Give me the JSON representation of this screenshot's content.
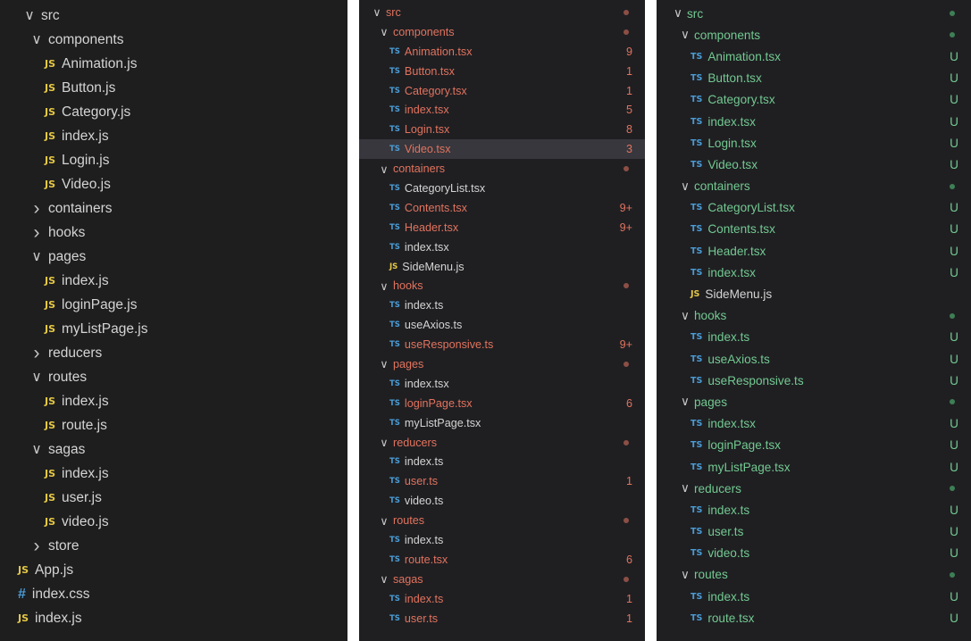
{
  "colors": {
    "default": "#d4d4d4",
    "modified": "#e2735e",
    "untracked": "#73c991",
    "modified_dot": "#8c4f45",
    "untracked_dot": "#3e7f55"
  },
  "panels": [
    {
      "id": "p1",
      "rows": [
        {
          "indent": 0,
          "kind": "folder",
          "open": true,
          "name": "src"
        },
        {
          "indent": 1,
          "kind": "folder",
          "open": true,
          "name": "components"
        },
        {
          "indent": 2,
          "kind": "file",
          "ft": "JS",
          "name": "Animation.js"
        },
        {
          "indent": 2,
          "kind": "file",
          "ft": "JS",
          "name": "Button.js"
        },
        {
          "indent": 2,
          "kind": "file",
          "ft": "JS",
          "name": "Category.js"
        },
        {
          "indent": 2,
          "kind": "file",
          "ft": "JS",
          "name": "index.js"
        },
        {
          "indent": 2,
          "kind": "file",
          "ft": "JS",
          "name": "Login.js"
        },
        {
          "indent": 2,
          "kind": "file",
          "ft": "JS",
          "name": "Video.js"
        },
        {
          "indent": 1,
          "kind": "folder",
          "open": false,
          "name": "containers"
        },
        {
          "indent": 1,
          "kind": "folder",
          "open": false,
          "name": "hooks"
        },
        {
          "indent": 1,
          "kind": "folder",
          "open": true,
          "name": "pages"
        },
        {
          "indent": 2,
          "kind": "file",
          "ft": "JS",
          "name": "index.js"
        },
        {
          "indent": 2,
          "kind": "file",
          "ft": "JS",
          "name": "loginPage.js"
        },
        {
          "indent": 2,
          "kind": "file",
          "ft": "JS",
          "name": "myListPage.js"
        },
        {
          "indent": 1,
          "kind": "folder",
          "open": false,
          "name": "reducers"
        },
        {
          "indent": 1,
          "kind": "folder",
          "open": true,
          "name": "routes"
        },
        {
          "indent": 2,
          "kind": "file",
          "ft": "JS",
          "name": "index.js"
        },
        {
          "indent": 2,
          "kind": "file",
          "ft": "JS",
          "name": "route.js"
        },
        {
          "indent": 1,
          "kind": "folder",
          "open": true,
          "name": "sagas"
        },
        {
          "indent": 2,
          "kind": "file",
          "ft": "JS",
          "name": "index.js"
        },
        {
          "indent": 2,
          "kind": "file",
          "ft": "JS",
          "name": "user.js"
        },
        {
          "indent": 2,
          "kind": "file",
          "ft": "JS",
          "name": "video.js"
        },
        {
          "indent": 1,
          "kind": "folder",
          "open": false,
          "name": "store"
        },
        {
          "indent": 1,
          "kind": "file",
          "ft": "JS",
          "name": "App.js"
        },
        {
          "indent": 1,
          "kind": "file",
          "ft": "#",
          "name": "index.css"
        },
        {
          "indent": 1,
          "kind": "file",
          "ft": "JS",
          "name": "index.js"
        }
      ]
    },
    {
      "id": "p2",
      "rows": [
        {
          "indent": 0,
          "kind": "folder",
          "open": true,
          "name": "src",
          "status": "modified",
          "dot": true
        },
        {
          "indent": 1,
          "kind": "folder",
          "open": true,
          "name": "components",
          "status": "modified",
          "dot": true
        },
        {
          "indent": 2,
          "kind": "file",
          "ft": "TS",
          "name": "Animation.tsx",
          "status": "modified",
          "badge": "9"
        },
        {
          "indent": 2,
          "kind": "file",
          "ft": "TS",
          "name": "Button.tsx",
          "status": "modified",
          "badge": "1"
        },
        {
          "indent": 2,
          "kind": "file",
          "ft": "TS",
          "name": "Category.tsx",
          "status": "modified",
          "badge": "1"
        },
        {
          "indent": 2,
          "kind": "file",
          "ft": "TS",
          "name": "index.tsx",
          "status": "modified",
          "badge": "5"
        },
        {
          "indent": 2,
          "kind": "file",
          "ft": "TS",
          "name": "Login.tsx",
          "status": "modified",
          "badge": "8"
        },
        {
          "indent": 2,
          "kind": "file",
          "ft": "TS",
          "name": "Video.tsx",
          "status": "modified",
          "badge": "3",
          "selected": true
        },
        {
          "indent": 1,
          "kind": "folder",
          "open": true,
          "name": "containers",
          "status": "modified",
          "dot": true
        },
        {
          "indent": 2,
          "kind": "file",
          "ft": "TS",
          "name": "CategoryList.tsx"
        },
        {
          "indent": 2,
          "kind": "file",
          "ft": "TS",
          "name": "Contents.tsx",
          "status": "modified",
          "badge": "9+"
        },
        {
          "indent": 2,
          "kind": "file",
          "ft": "TS",
          "name": "Header.tsx",
          "status": "modified",
          "badge": "9+"
        },
        {
          "indent": 2,
          "kind": "file",
          "ft": "TS",
          "name": "index.tsx"
        },
        {
          "indent": 2,
          "kind": "file",
          "ft": "JS",
          "name": "SideMenu.js"
        },
        {
          "indent": 1,
          "kind": "folder",
          "open": true,
          "name": "hooks",
          "status": "modified",
          "dot": true
        },
        {
          "indent": 2,
          "kind": "file",
          "ft": "TS",
          "name": "index.ts"
        },
        {
          "indent": 2,
          "kind": "file",
          "ft": "TS",
          "name": "useAxios.ts"
        },
        {
          "indent": 2,
          "kind": "file",
          "ft": "TS",
          "name": "useResponsive.ts",
          "status": "modified",
          "badge": "9+"
        },
        {
          "indent": 1,
          "kind": "folder",
          "open": true,
          "name": "pages",
          "status": "modified",
          "dot": true
        },
        {
          "indent": 2,
          "kind": "file",
          "ft": "TS",
          "name": "index.tsx"
        },
        {
          "indent": 2,
          "kind": "file",
          "ft": "TS",
          "name": "loginPage.tsx",
          "status": "modified",
          "badge": "6"
        },
        {
          "indent": 2,
          "kind": "file",
          "ft": "TS",
          "name": "myListPage.tsx"
        },
        {
          "indent": 1,
          "kind": "folder",
          "open": true,
          "name": "reducers",
          "status": "modified",
          "dot": true
        },
        {
          "indent": 2,
          "kind": "file",
          "ft": "TS",
          "name": "index.ts"
        },
        {
          "indent": 2,
          "kind": "file",
          "ft": "TS",
          "name": "user.ts",
          "status": "modified",
          "badge": "1"
        },
        {
          "indent": 2,
          "kind": "file",
          "ft": "TS",
          "name": "video.ts"
        },
        {
          "indent": 1,
          "kind": "folder",
          "open": true,
          "name": "routes",
          "status": "modified",
          "dot": true
        },
        {
          "indent": 2,
          "kind": "file",
          "ft": "TS",
          "name": "index.ts"
        },
        {
          "indent": 2,
          "kind": "file",
          "ft": "TS",
          "name": "route.tsx",
          "status": "modified",
          "badge": "6"
        },
        {
          "indent": 1,
          "kind": "folder",
          "open": true,
          "name": "sagas",
          "status": "modified",
          "dot": true
        },
        {
          "indent": 2,
          "kind": "file",
          "ft": "TS",
          "name": "index.ts",
          "status": "modified",
          "badge": "1"
        },
        {
          "indent": 2,
          "kind": "file",
          "ft": "TS",
          "name": "user.ts",
          "status": "modified",
          "badge": "1"
        }
      ]
    },
    {
      "id": "p3",
      "rows": [
        {
          "indent": 0,
          "kind": "folder",
          "open": true,
          "name": "src",
          "status": "untracked",
          "dot": true
        },
        {
          "indent": 1,
          "kind": "folder",
          "open": true,
          "name": "components",
          "status": "untracked",
          "dot": true
        },
        {
          "indent": 2,
          "kind": "file",
          "ft": "TS",
          "name": "Animation.tsx",
          "status": "untracked",
          "badge": "U"
        },
        {
          "indent": 2,
          "kind": "file",
          "ft": "TS",
          "name": "Button.tsx",
          "status": "untracked",
          "badge": "U"
        },
        {
          "indent": 2,
          "kind": "file",
          "ft": "TS",
          "name": "Category.tsx",
          "status": "untracked",
          "badge": "U"
        },
        {
          "indent": 2,
          "kind": "file",
          "ft": "TS",
          "name": "index.tsx",
          "status": "untracked",
          "badge": "U"
        },
        {
          "indent": 2,
          "kind": "file",
          "ft": "TS",
          "name": "Login.tsx",
          "status": "untracked",
          "badge": "U"
        },
        {
          "indent": 2,
          "kind": "file",
          "ft": "TS",
          "name": "Video.tsx",
          "status": "untracked",
          "badge": "U"
        },
        {
          "indent": 1,
          "kind": "folder",
          "open": true,
          "name": "containers",
          "status": "untracked",
          "dot": true
        },
        {
          "indent": 2,
          "kind": "file",
          "ft": "TS",
          "name": "CategoryList.tsx",
          "status": "untracked",
          "badge": "U"
        },
        {
          "indent": 2,
          "kind": "file",
          "ft": "TS",
          "name": "Contents.tsx",
          "status": "untracked",
          "badge": "U"
        },
        {
          "indent": 2,
          "kind": "file",
          "ft": "TS",
          "name": "Header.tsx",
          "status": "untracked",
          "badge": "U"
        },
        {
          "indent": 2,
          "kind": "file",
          "ft": "TS",
          "name": "index.tsx",
          "status": "untracked",
          "badge": "U"
        },
        {
          "indent": 2,
          "kind": "file",
          "ft": "JS",
          "name": "SideMenu.js"
        },
        {
          "indent": 1,
          "kind": "folder",
          "open": true,
          "name": "hooks",
          "status": "untracked",
          "dot": true
        },
        {
          "indent": 2,
          "kind": "file",
          "ft": "TS",
          "name": "index.ts",
          "status": "untracked",
          "badge": "U"
        },
        {
          "indent": 2,
          "kind": "file",
          "ft": "TS",
          "name": "useAxios.ts",
          "status": "untracked",
          "badge": "U"
        },
        {
          "indent": 2,
          "kind": "file",
          "ft": "TS",
          "name": "useResponsive.ts",
          "status": "untracked",
          "badge": "U"
        },
        {
          "indent": 1,
          "kind": "folder",
          "open": true,
          "name": "pages",
          "status": "untracked",
          "dot": true
        },
        {
          "indent": 2,
          "kind": "file",
          "ft": "TS",
          "name": "index.tsx",
          "status": "untracked",
          "badge": "U"
        },
        {
          "indent": 2,
          "kind": "file",
          "ft": "TS",
          "name": "loginPage.tsx",
          "status": "untracked",
          "badge": "U"
        },
        {
          "indent": 2,
          "kind": "file",
          "ft": "TS",
          "name": "myListPage.tsx",
          "status": "untracked",
          "badge": "U"
        },
        {
          "indent": 1,
          "kind": "folder",
          "open": true,
          "name": "reducers",
          "status": "untracked",
          "dot": true
        },
        {
          "indent": 2,
          "kind": "file",
          "ft": "TS",
          "name": "index.ts",
          "status": "untracked",
          "badge": "U"
        },
        {
          "indent": 2,
          "kind": "file",
          "ft": "TS",
          "name": "user.ts",
          "status": "untracked",
          "badge": "U"
        },
        {
          "indent": 2,
          "kind": "file",
          "ft": "TS",
          "name": "video.ts",
          "status": "untracked",
          "badge": "U"
        },
        {
          "indent": 1,
          "kind": "folder",
          "open": true,
          "name": "routes",
          "status": "untracked",
          "dot": true
        },
        {
          "indent": 2,
          "kind": "file",
          "ft": "TS",
          "name": "index.ts",
          "status": "untracked",
          "badge": "U"
        },
        {
          "indent": 2,
          "kind": "file",
          "ft": "TS",
          "name": "route.tsx",
          "status": "untracked",
          "badge": "U"
        }
      ]
    }
  ]
}
